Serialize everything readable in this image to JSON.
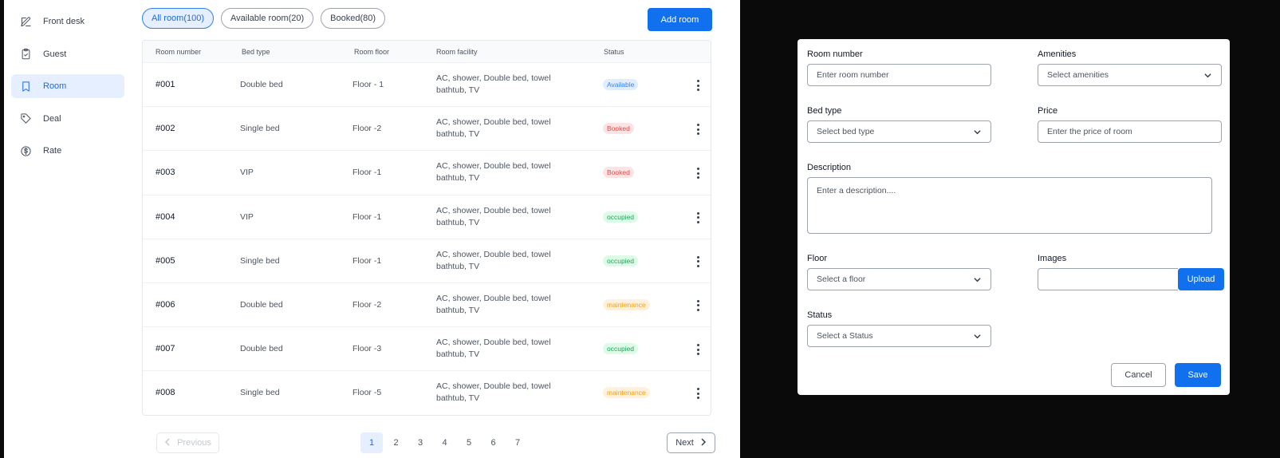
{
  "sidebar": {
    "items": [
      {
        "label": "Front desk",
        "icon": "edit-icon"
      },
      {
        "label": "Guest",
        "icon": "clipboard-icon"
      },
      {
        "label": "Room",
        "icon": "bookmark-icon"
      },
      {
        "label": "Deal",
        "icon": "tag-icon"
      },
      {
        "label": "Rate",
        "icon": "dollar-circle-icon"
      }
    ],
    "active_index": 2
  },
  "tabs": [
    {
      "label": "All room(100)"
    },
    {
      "label": "Available room(20)"
    },
    {
      "label": "Booked(80)"
    }
  ],
  "add_room_label": "Add room",
  "table": {
    "headers": [
      "Room number",
      "Bed type",
      "Room floor",
      "Room facility",
      "Status"
    ],
    "rows": [
      {
        "num": "#001",
        "bed": "Double bed",
        "floor": "Floor - 1",
        "facility": "AC, shower, Double bed, towel bathtub, TV",
        "status": "Available"
      },
      {
        "num": "#002",
        "bed": "Single bed",
        "floor": "Floor -2",
        "facility": "AC, shower, Double bed, towel bathtub, TV",
        "status": "Booked"
      },
      {
        "num": "#003",
        "bed": "VIP",
        "floor": "Floor -1",
        "facility": "AC, shower, Double bed, towel bathtub, TV",
        "status": "Booked"
      },
      {
        "num": "#004",
        "bed": "VIP",
        "floor": "Floor -1",
        "facility": "AC, shower, Double bed, towel bathtub, TV",
        "status": "occupied"
      },
      {
        "num": "#005",
        "bed": "Single bed",
        "floor": "Floor -1",
        "facility": "AC, shower, Double bed, towel bathtub, TV",
        "status": "occupied"
      },
      {
        "num": "#006",
        "bed": "Double bed",
        "floor": "Floor -2",
        "facility": "AC, shower, Double bed, towel bathtub, TV",
        "status": "maintenance"
      },
      {
        "num": "#007",
        "bed": "Double bed",
        "floor": "Floor -3",
        "facility": "AC, shower, Double bed, towel bathtub, TV",
        "status": "occupied"
      },
      {
        "num": "#008",
        "bed": "Single bed",
        "floor": "Floor -5",
        "facility": "AC, shower, Double bed, towel bathtub, TV",
        "status": "maintenance"
      }
    ]
  },
  "status_colors": {
    "Available": {
      "bg": "#e0edff",
      "fg": "#3b82f6"
    },
    "Booked": {
      "bg": "#fde4e4",
      "fg": "#ef4444"
    },
    "occupied": {
      "bg": "#dcfce7",
      "fg": "#22a35a"
    },
    "maintenance": {
      "bg": "#fff1dd",
      "fg": "#f59e0b"
    }
  },
  "pagination": {
    "previous": "Previous",
    "next": "Next",
    "pages": [
      "1",
      "2",
      "3",
      "4",
      "5",
      "6",
      "7"
    ],
    "current": "1"
  },
  "form": {
    "room_number": {
      "label": "Room number",
      "placeholder": "Enter room number"
    },
    "amenities": {
      "label": "Amenities",
      "placeholder": "Select amenities"
    },
    "bed_type": {
      "label": "Bed type",
      "placeholder": "Select bed type"
    },
    "price": {
      "label": "Price",
      "placeholder": "Enter the price of room"
    },
    "description": {
      "label": "Description",
      "placeholder": "Enter a description...."
    },
    "floor": {
      "label": "Floor",
      "placeholder": "Select a floor"
    },
    "images": {
      "label": "Images",
      "upload": "Upload"
    },
    "status": {
      "label": "Status",
      "placeholder": "Select a Status"
    },
    "cancel": "Cancel",
    "save": "Save"
  },
  "colors": {
    "accent": "#1070ee",
    "active_bg": "#e5efff"
  }
}
